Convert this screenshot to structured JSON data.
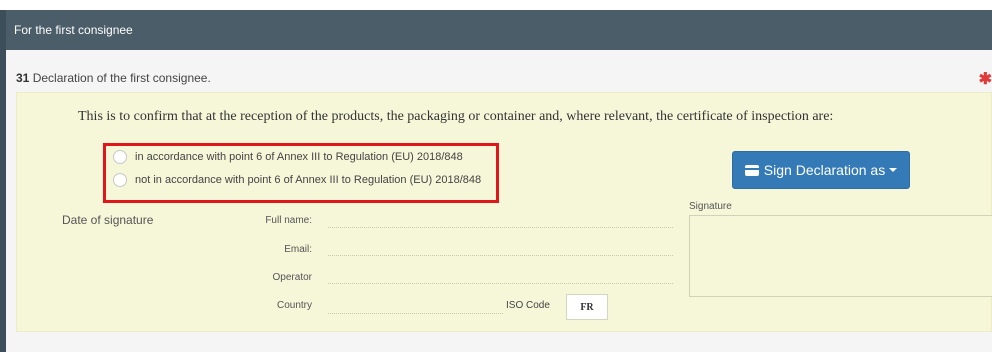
{
  "panel": {
    "title": "For the first consignee"
  },
  "section": {
    "number": "31",
    "title": "Declaration of the first consignee.",
    "required_marker": "✱"
  },
  "declaration": {
    "confirm_text": "This is to confirm that at the reception of the products, the packaging or container and, where relevant, the certificate of inspection are:",
    "options": [
      {
        "label": "in accordance with point 6 of Annex III to Regulation (EU) 2018/848",
        "selected": false
      },
      {
        "label": "not in accordance with point 6 of Annex III to Regulation (EU) 2018/848",
        "selected": false
      }
    ]
  },
  "signature_fields": {
    "date_label": "Date of signature",
    "full_name_label": "Full name:",
    "email_label": "Email:",
    "operator_label": "Operator",
    "country_label": "Country",
    "iso_code_label": "ISO Code",
    "iso_code_value": "FR"
  },
  "signature": {
    "label": "Signature",
    "button_label": "Sign Declaration as",
    "button_icon": "credit-card-icon"
  },
  "colors": {
    "header_bg": "#4b5d68",
    "declaration_bg": "#f6f6d9",
    "highlight": "#e0161b",
    "button": "#337ab7",
    "required": "#e03a3a"
  }
}
